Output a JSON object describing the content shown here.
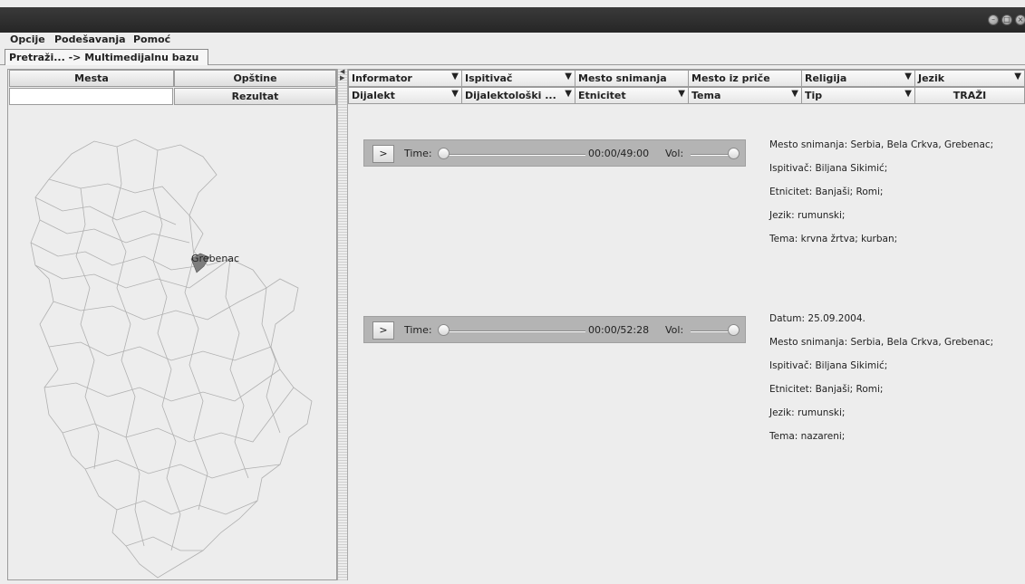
{
  "menubar": {
    "items": [
      "Opcije",
      "Podešavanja",
      "Pomoć"
    ]
  },
  "tab": {
    "label": "Pretraži... -> Multimedijalnu bazu"
  },
  "left": {
    "mesta": "Mesta",
    "opstine": "Opštine",
    "rezultat": "Rezultat",
    "search_value": ""
  },
  "map": {
    "marker_label": "Grebenac"
  },
  "filters": {
    "row1": [
      {
        "label": "Informator",
        "dropdown": true
      },
      {
        "label": "Ispitivač",
        "dropdown": true
      },
      {
        "label": "Mesto snimanja",
        "dropdown": false
      },
      {
        "label": "Mesto iz priče",
        "dropdown": false
      },
      {
        "label": "Religija",
        "dropdown": true
      },
      {
        "label": "Jezik",
        "dropdown": true
      }
    ],
    "row2": [
      {
        "label": "Dijalekt",
        "dropdown": true
      },
      {
        "label": "Dijalektološki ...",
        "dropdown": true
      },
      {
        "label": "Etnicitet",
        "dropdown": true
      },
      {
        "label": "Tema",
        "dropdown": true
      },
      {
        "label": "Tip",
        "dropdown": true
      }
    ],
    "search_button": "TRAŽI"
  },
  "results": [
    {
      "player": {
        "play": ">",
        "time_label": "Time:",
        "time": "00:00/49:00",
        "vol_label": "Vol:"
      },
      "info": [
        "Mesto snimanja: Serbia, Bela Crkva, Grebenac;",
        "Ispitivač: Biljana Sikimić;",
        "Etnicitet: Banjaši;  Romi;",
        "Jezik: rumunski;",
        "Tema: krvna žrtva;  kurban;"
      ]
    },
    {
      "player": {
        "play": ">",
        "time_label": "Time:",
        "time": "00:00/52:28",
        "vol_label": "Vol:"
      },
      "info": [
        "Datum: 25.09.2004.",
        "Mesto snimanja: Serbia, Bela Crkva, Grebenac;",
        "Ispitivač: Biljana Sikimić;",
        "Etnicitet: Banjaši;  Romi;",
        "Jezik: rumunski;",
        "Tema: nazareni;"
      ]
    }
  ]
}
